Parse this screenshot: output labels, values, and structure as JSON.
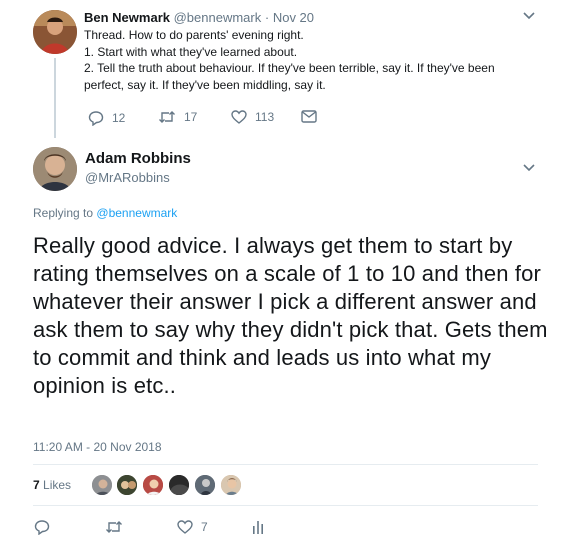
{
  "parent_tweet": {
    "name": "Ben Newmark",
    "handle": "@bennewmark",
    "separator": "·",
    "date": "Nov 20",
    "lines": [
      "Thread. How to do parents' evening right.",
      "1. Start with what they've learned about.",
      "2. Tell the truth about  behaviour. If they've been terrible, say it. If they've been",
      "perfect, say it. If they've been middling, say it."
    ],
    "reply_count": "12",
    "retweet_count": "17",
    "like_count": "113"
  },
  "main_tweet": {
    "name": "Adam Robbins",
    "handle": "@MrARobbins",
    "replying_prefix": "Replying to",
    "replying_to": "@bennewmark",
    "text": "Really good advice. I always get them to start by rating themselves on a scale of 1 to 10 and then for whatever their answer I pick a different answer and ask them to say why they didn't pick that. Gets them to commit and think and leads us into what my opinion is etc..",
    "timestamp": "11:20 AM - 20 Nov 2018",
    "likes_count": "7",
    "likes_label": "Likes",
    "like_action_count": "7"
  },
  "colors": {
    "accent": "#1da1f2",
    "muted": "#657786",
    "text": "#14171a",
    "divider": "#e6ecf0"
  },
  "icons": {
    "caret": "chevron-down-icon",
    "reply": "reply-icon",
    "retweet": "retweet-icon",
    "like": "heart-icon",
    "dm": "envelope-icon",
    "analytics": "bar-chart-icon"
  }
}
